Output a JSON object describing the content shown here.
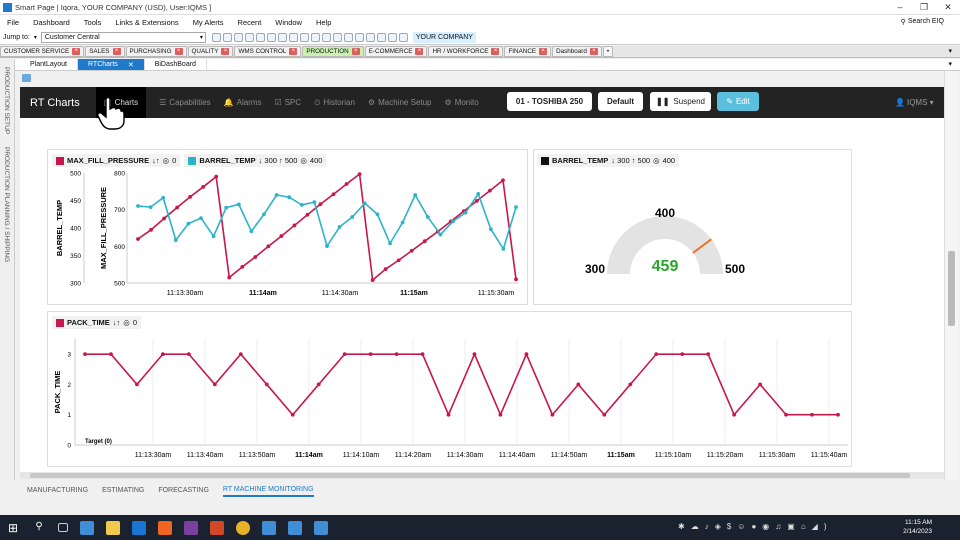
{
  "window": {
    "title": "Smart Page | Iqora, YOUR COMPANY (USD), User:IQMS ]",
    "min": "–",
    "restore": "❐",
    "close": "✕"
  },
  "menu": [
    "File",
    "Dashboard",
    "Tools",
    "Links & Extensions",
    "My Alerts",
    "Recent",
    "Window",
    "Help"
  ],
  "search_eiq": "Search EIQ",
  "toolbar": {
    "jump_to": "Jump to:",
    "jump_value": "Customer Central",
    "company": "YOUR COMPANY"
  },
  "modules": [
    {
      "label": "CUSTOMER SERVICE",
      "color": "#f2f2f2"
    },
    {
      "label": "SALES",
      "color": "#f2f2f2"
    },
    {
      "label": "PURCHASING",
      "color": "#f2f2f2"
    },
    {
      "label": "QUALITY",
      "color": "#f2f2f2"
    },
    {
      "label": "WMS CONTROL",
      "color": "#f2f2f2"
    },
    {
      "label": "PRODUCTION",
      "color": "#c9f2b0"
    },
    {
      "label": "E-COMMERCE",
      "color": "#f2f2f2"
    },
    {
      "label": "HR / WORKFORCE",
      "color": "#f2f2f2"
    },
    {
      "label": "FINANCE",
      "color": "#f2f2f2"
    },
    {
      "label": "Dashboard",
      "color": "#f2f2f2"
    }
  ],
  "tabs": [
    {
      "label": "PlantLayout",
      "active": false
    },
    {
      "label": "RTCharts",
      "active": true
    },
    {
      "label": "BiDashBoard",
      "active": false
    }
  ],
  "sidebar": [
    "PRODUCTION SETUP",
    "PRODUCTION PLANNING / SHIPPING"
  ],
  "app": {
    "brand": "RT Charts",
    "nav": [
      {
        "label": "Charts",
        "icon": "▥",
        "active": true
      },
      {
        "label": "Capabilities",
        "icon": "☰",
        "active": false
      },
      {
        "label": "Alarms",
        "icon": "🔔",
        "active": false
      },
      {
        "label": "SPC",
        "icon": "☑",
        "active": false
      },
      {
        "label": "Historian",
        "icon": "⏲",
        "active": false
      },
      {
        "label": "Machine Setup",
        "icon": "⚙",
        "active": false
      },
      {
        "label": "Monito",
        "icon": "⚙",
        "active": false
      }
    ],
    "machine": "01 - TOSHIBA 250",
    "default_btn": "Default",
    "suspend_btn": "Suspend",
    "edit_btn": "Edit",
    "user": "IQMS ▾"
  },
  "colors": {
    "red": "#c8174a",
    "cyan": "#2db3c8",
    "green": "#2aa62a",
    "orange": "#e8742a"
  },
  "chart1": {
    "legend": [
      {
        "name": "MAX_FILL_PRESSURE",
        "color": "#c8174a",
        "arrows": "↓↑",
        "count": "0"
      },
      {
        "name": "BARREL_TEMP",
        "color": "#2db3c8",
        "arrows": "↓ 300 ↑ 500",
        "count": "400"
      }
    ]
  },
  "gauge": {
    "legend": {
      "name": "BARREL_TEMP",
      "arrows": "↓ 300 ↑ 500",
      "count": "400"
    },
    "value": "459",
    "min": "300",
    "max": "500",
    "target": "400",
    "fraction": 0.795
  },
  "chart2": {
    "legend": {
      "name": "PACK_TIME",
      "color": "#c8174a",
      "arrows": "↓↑",
      "count": "0"
    },
    "target_label": "Target (0)"
  },
  "chart_data": [
    {
      "type": "line",
      "title": "",
      "x": [
        "11:13:30am",
        "11:14am",
        "11:14:30am",
        "11:15am",
        "11:15:30am"
      ],
      "x_bold": [
        false,
        true,
        false,
        true,
        false
      ],
      "axes": [
        {
          "label": "BARREL_TEMP",
          "ticks": [
            "300",
            "350",
            "400",
            "450",
            "500"
          ],
          "ylim": [
            300,
            500
          ]
        },
        {
          "label": "MAX_FILL_PRESSURE",
          "ticks": [
            "500",
            "600",
            "700",
            "800"
          ],
          "ylim": [
            500,
            800
          ]
        }
      ],
      "series": [
        {
          "name": "MAX_FILL_PRESSURE",
          "axis": 1,
          "values": [
            620,
            645,
            676,
            706,
            735,
            762,
            790,
            515,
            544,
            571,
            600,
            628,
            657,
            686,
            715,
            742,
            770,
            797,
            508,
            538,
            562,
            588,
            614,
            640,
            668,
            696,
            724,
            752,
            780,
            510
          ]
        },
        {
          "name": "BARREL_TEMP",
          "axis": 0,
          "values": [
            440,
            438,
            455,
            378,
            408,
            418,
            385,
            437,
            443,
            394,
            425,
            460,
            456,
            442,
            447,
            367,
            402,
            420,
            445,
            425,
            372,
            410,
            460,
            420,
            388,
            412,
            428,
            462,
            398,
            362,
            438
          ]
        }
      ]
    },
    {
      "type": "line",
      "title": "",
      "ylabel": "PACK_TIME",
      "yticks": [
        "0",
        "1",
        "2",
        "3"
      ],
      "ylim": [
        0,
        3.5
      ],
      "x": [
        "11:13:30am",
        "11:13:40am",
        "11:13:50am",
        "11:14am",
        "11:14:10am",
        "11:14:20am",
        "11:14:30am",
        "11:14:40am",
        "11:14:50am",
        "11:15am",
        "11:15:10am",
        "11:15:20am",
        "11:15:30am",
        "11:15:40am"
      ],
      "x_bold": [
        false,
        false,
        false,
        true,
        false,
        false,
        false,
        false,
        false,
        true,
        false,
        false,
        false,
        false
      ],
      "series": [
        {
          "name": "PACK_TIME",
          "values": [
            3,
            3,
            2,
            3,
            3,
            2,
            3,
            2,
            1,
            2,
            3,
            3,
            3,
            3,
            1,
            3,
            1,
            3,
            1,
            2,
            1,
            2,
            3,
            3,
            3,
            1,
            2,
            1,
            1,
            1
          ]
        }
      ]
    }
  ],
  "statusbar": [
    {
      "label": "MANUFACTURING",
      "active": false
    },
    {
      "label": "ESTIMATING",
      "active": false
    },
    {
      "label": "FORECASTING",
      "active": false
    },
    {
      "label": "RT MACHINE MONITORING",
      "active": true
    }
  ],
  "clock": {
    "time": "11:15 AM",
    "date": "2/14/2023"
  }
}
